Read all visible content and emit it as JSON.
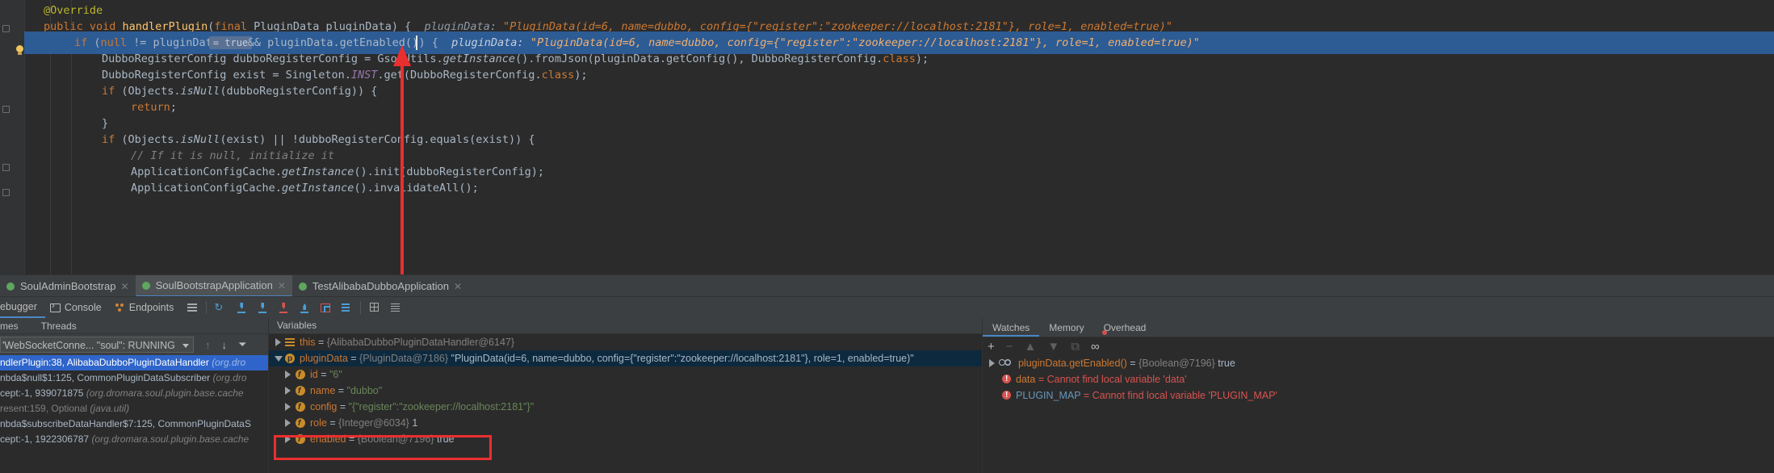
{
  "editor": {
    "lines": [
      {
        "parts": [
          [
            "an",
            "@Override"
          ]
        ]
      },
      {
        "parts": [
          [
            "kw",
            "public void "
          ],
          [
            "fn",
            "handlerPlugin"
          ],
          [
            "",
            "("
          ],
          [
            "kw",
            "final "
          ],
          [
            "",
            "PluginData pluginData) {  "
          ],
          [
            "hint",
            "pluginData: "
          ],
          [
            "hintv",
            "\"PluginData(id=6, name=dubbo, config={\"register\":\"zookeeper://localhost:2181\"}, role=1, enabled=true)\""
          ]
        ]
      },
      {
        "parts": [
          [
            "kw",
            "if "
          ],
          [
            "",
            "("
          ],
          [
            "kw",
            "null "
          ],
          [
            "",
            "!= pluginData "
          ]
        ]
      },
      {
        "parts": [
          [
            "",
            "DubboRegisterConfig dubboRegisterConfig = GsonUtils."
          ],
          [
            "it",
            "getInstance"
          ],
          [
            "",
            "().fromJson(pluginData.getConfig(), DubboRegisterConfig."
          ],
          [
            "kw",
            "class"
          ],
          [
            "",
            ");"
          ]
        ]
      },
      {
        "parts": [
          [
            "",
            "DubboRegisterConfig exist = Singleton."
          ],
          [
            "st",
            "INST"
          ],
          [
            "",
            ".get(DubboRegisterConfig."
          ],
          [
            "kw",
            "class"
          ],
          [
            "",
            ");"
          ]
        ]
      },
      {
        "parts": [
          [
            "kw",
            "if "
          ],
          [
            "",
            "(Objects."
          ],
          [
            "it",
            "isNull"
          ],
          [
            "",
            "(dubboRegisterConfig)) {"
          ]
        ]
      },
      {
        "parts": [
          [
            "kw",
            "return"
          ],
          [
            "",
            ";"
          ]
        ]
      },
      {
        "parts": [
          [
            "",
            "}"
          ]
        ]
      },
      {
        "parts": [
          [
            "kw",
            "if "
          ],
          [
            "",
            "(Objects."
          ],
          [
            "it",
            "isNull"
          ],
          [
            "",
            "(exist) || !dubboRegisterConfig.equals(exist)) {"
          ]
        ]
      },
      {
        "parts": [
          [
            "cm",
            "// If it is null, initialize it"
          ]
        ]
      },
      {
        "parts": [
          [
            "",
            "ApplicationConfigCache."
          ],
          [
            "it",
            "getInstance"
          ],
          [
            "",
            "().init(dubboRegisterConfig);"
          ]
        ]
      },
      {
        "parts": [
          [
            "",
            "ApplicationConfigCache."
          ],
          [
            "it",
            "getInstance"
          ],
          [
            "",
            "().invalidateAll();"
          ]
        ]
      }
    ],
    "inline_chip": "= true",
    "line2_rest": "&& pluginData.getEnabled()",
    "line2_brace": ") {  ",
    "line2_hint_label": "pluginData: ",
    "line2_hint_value": "\"PluginData(id=6, name=dubbo, config={\"register\":\"zookeeper://localhost:2181\"}, role=1, enabled=true)\""
  },
  "run_tabs": [
    {
      "label": "SoulAdminBootstrap"
    },
    {
      "label": "SoulBootstrapApplication"
    },
    {
      "label": "TestAlibabaDubboApplication"
    }
  ],
  "debug_tabs": {
    "debugger": "ebugger",
    "console": "Console",
    "endpoints": "Endpoints"
  },
  "frames": {
    "header_frames": "mes",
    "header_threads": "Threads",
    "thread_selector": "'WebSocketConne... \"soul\": RUNNING",
    "items": [
      {
        "text": "ndlerPlugin:38, AlibabaDubboPluginDataHandler ",
        "pkg": "(org.dro",
        "selected": true
      },
      {
        "text": "nbda$null$1:125, CommonPluginDataSubscriber ",
        "pkg": "(org.dro",
        "selected": false
      },
      {
        "text": "cept:-1, 939071875 ",
        "pkg": "(org.dromara.soul.plugin.base.cache",
        "selected": false
      },
      {
        "text": "resent:159, Optional ",
        "pkg": "(java.util)",
        "selected": false,
        "dim": true
      },
      {
        "text": "nbda$subscribeDataHandler$7:125, CommonPluginDataS",
        "pkg": "",
        "selected": false
      },
      {
        "text": "cept:-1, 1922306787 ",
        "pkg": "(org.dromara.soul.plugin.base.cache",
        "selected": false
      }
    ]
  },
  "variables": {
    "header": "Variables",
    "this": {
      "name": "this",
      "type": "{AlibabaDubboPluginDataHandler@6147}"
    },
    "pluginData": {
      "name": "pluginData",
      "type": "{PluginData@7186}",
      "value": "\"PluginData(id=6, name=dubbo, config={\"register\":\"zookeeper://localhost:2181\"}, role=1, enabled=true)\""
    },
    "fields": [
      {
        "name": "id",
        "type": "",
        "value": "\"6\"",
        "kind": "str"
      },
      {
        "name": "name",
        "type": "",
        "value": "\"dubbo\"",
        "kind": "str"
      },
      {
        "name": "config",
        "type": "",
        "value": "\"{\"register\":\"zookeeper://localhost:2181\"}\"",
        "kind": "str"
      },
      {
        "name": "role",
        "type": "{Integer@6034}",
        "value": "1",
        "kind": "num"
      },
      {
        "name": "enabled",
        "type": "{Boolean@7196}",
        "value": "true",
        "kind": "plain"
      }
    ]
  },
  "watches": {
    "tabs": [
      "Watches",
      "Memory",
      "Overhead"
    ],
    "items": [
      {
        "name": "pluginData.getEnabled()",
        "type": "{Boolean@7196}",
        "value": "true",
        "error": false
      },
      {
        "name": "data",
        "value": "Cannot find local variable 'data'",
        "error": true
      },
      {
        "name": "PLUGIN_MAP",
        "value": "Cannot find local variable 'PLUGIN_MAP'",
        "error": true
      }
    ]
  }
}
